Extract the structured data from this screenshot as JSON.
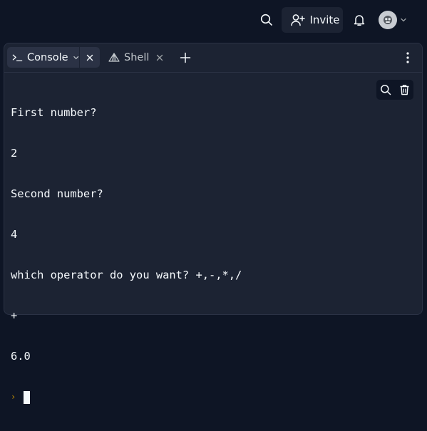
{
  "header": {
    "invite_label": "Invite"
  },
  "tabs": [
    {
      "label": "Console",
      "icon": "terminal-icon",
      "active": true
    },
    {
      "label": "Shell",
      "icon": "shell-icon",
      "active": false
    }
  ],
  "console": {
    "lines": [
      "First number?",
      "2",
      "Second number?",
      "4",
      "which operator do you want? +,-,*,/",
      "+",
      "6.0"
    ],
    "prompt_symbol": "›"
  },
  "colors": {
    "background": "#0e1525",
    "pane": "#1c2333",
    "active_tab": "#2b3245",
    "text": "#f5f9fc",
    "prompt": "#c08b00"
  }
}
